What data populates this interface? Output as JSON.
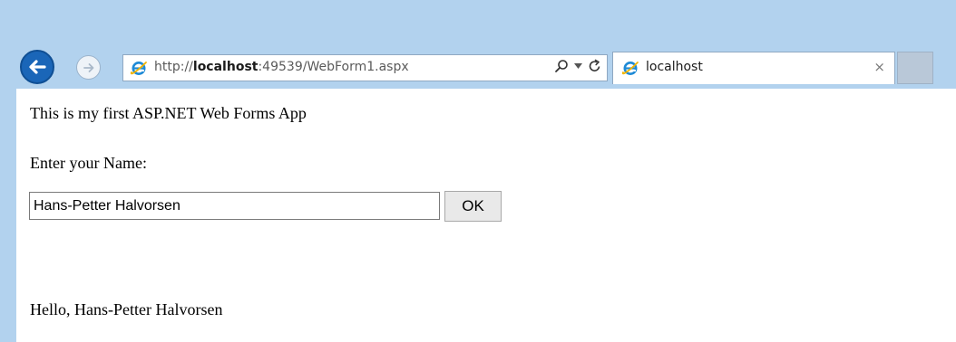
{
  "browser": {
    "address": {
      "prefix": "http://",
      "host": "localhost",
      "rest": ":49539/WebForm1.aspx"
    },
    "tab": {
      "title": "localhost",
      "close_glyph": "×"
    },
    "icons": {
      "back": "back-arrow-icon",
      "forward": "forward-arrow-icon",
      "site": "internet-explorer-icon",
      "search": "search-icon",
      "dropdown": "dropdown-icon",
      "refresh": "refresh-icon"
    },
    "colors": {
      "frame": "#b2d2ee",
      "back_button": "#1a66b8"
    }
  },
  "page": {
    "heading": "This is my first ASP.NET Web Forms App",
    "prompt_label": "Enter your Name:",
    "name_value": "Hans-Petter Halvorsen",
    "ok_label": "OK",
    "greeting": "Hello, Hans-Petter Halvorsen"
  }
}
